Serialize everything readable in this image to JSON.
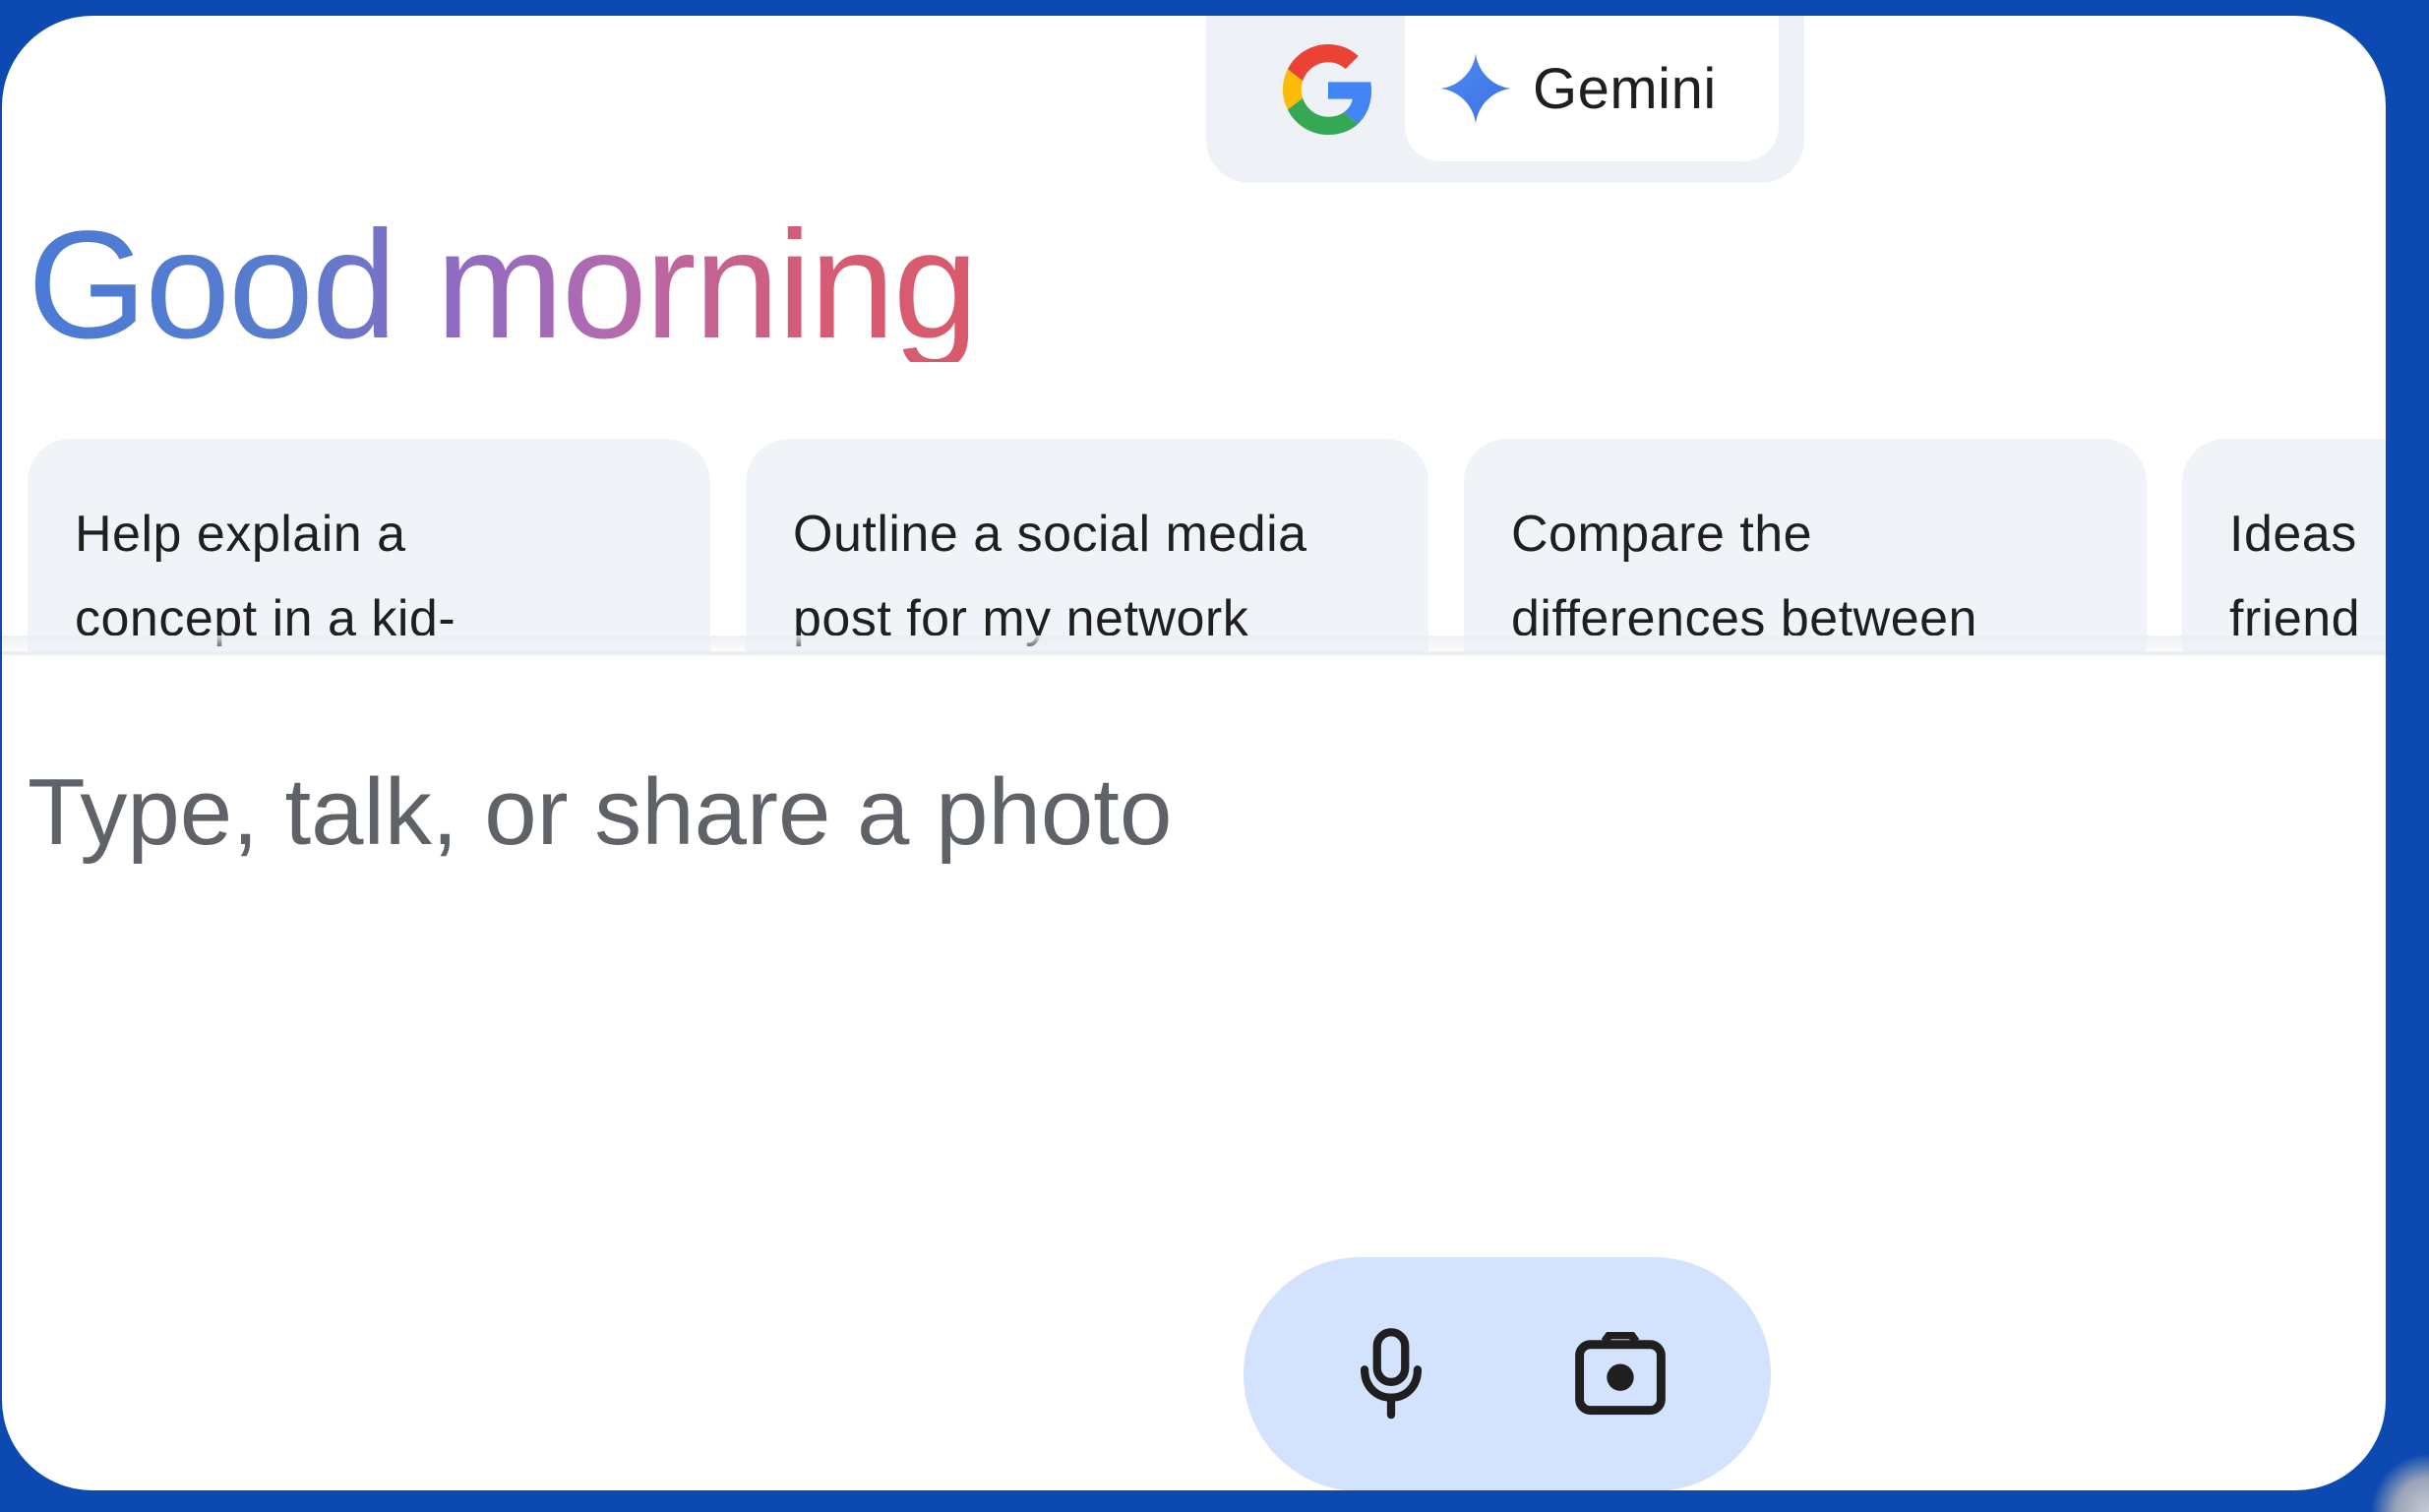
{
  "header": {
    "modes": [
      {
        "id": "google",
        "icon": "google-g-logo"
      },
      {
        "id": "gemini",
        "label": "Gemini",
        "icon": "gemini-sparkle-icon"
      }
    ],
    "selected_mode": "gemini"
  },
  "greeting": "Good morning",
  "suggestions": [
    {
      "line1": "Help explain a",
      "line2": "concept in a kid-"
    },
    {
      "line1": "Outline a social media",
      "line2": "post for my network"
    },
    {
      "line1": "Compare the",
      "line2": "differences between"
    },
    {
      "line1": "Ideas",
      "line2": "friend"
    }
  ],
  "prompt": {
    "placeholder": "Type, talk, or share a photo",
    "value": ""
  },
  "actions": [
    {
      "id": "microphone",
      "icon": "microphone-icon"
    },
    {
      "id": "camera",
      "icon": "camera-icon"
    }
  ],
  "colors": {
    "frame": "#0c49b0",
    "action_pill": "#d3e3fd",
    "card_bg": "#f0f4f8",
    "gemini_blue": "#4285f4",
    "greeting_start": "#4a7bd6",
    "greeting_end": "#da5a6a"
  }
}
